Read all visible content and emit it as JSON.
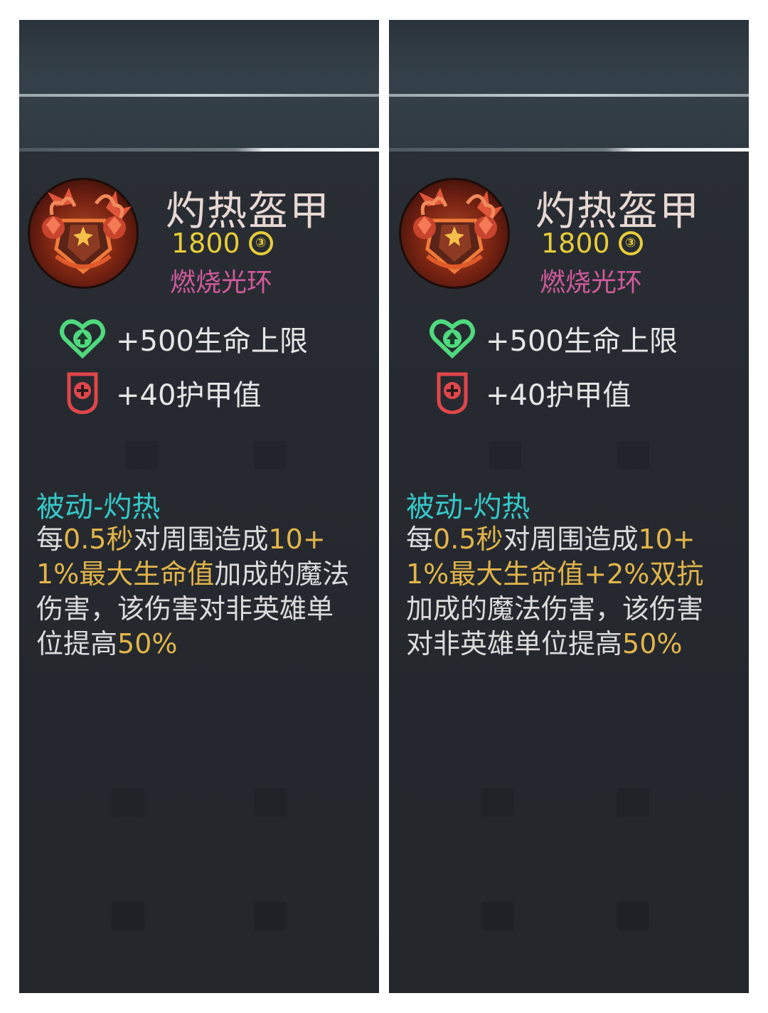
{
  "panels": [
    {
      "item_name": "灼热盔甲",
      "price": "1800",
      "coin_symbol": "③",
      "aura": "燃烧光环",
      "stats": [
        "+500生命上限",
        "+40护甲值"
      ],
      "passive_title": "被动-灼热",
      "desc": {
        "p1": "每",
        "p2": "0.5秒",
        "p3": "对周围造成",
        "p4": "10+1%最大生命值",
        "p5": "加成的魔法伤害，该伤害对非英雄单位提高",
        "p6": "50%"
      }
    },
    {
      "item_name": "灼热盔甲",
      "price": "1800",
      "coin_symbol": "③",
      "aura": "燃烧光环",
      "stats": [
        "+500生命上限",
        "+40护甲值"
      ],
      "passive_title": "被动-灼热",
      "desc": {
        "p1": "每",
        "p2": "0.5秒",
        "p3": "对周围造成",
        "p4": "10+1%最大生命值+2%双抗",
        "p5": "加成的魔法伤害，该伤害对非英雄单位提高",
        "p6": "50%"
      }
    }
  ],
  "colors": {
    "name": "#e7d8d3",
    "gold": "#e7cc3a",
    "aura": "#d05a9b",
    "passive_title": "#35c8c8",
    "highlight": "#e2b54a",
    "hp_icon": "#4fd97e",
    "armor_icon": "#e0464a"
  }
}
